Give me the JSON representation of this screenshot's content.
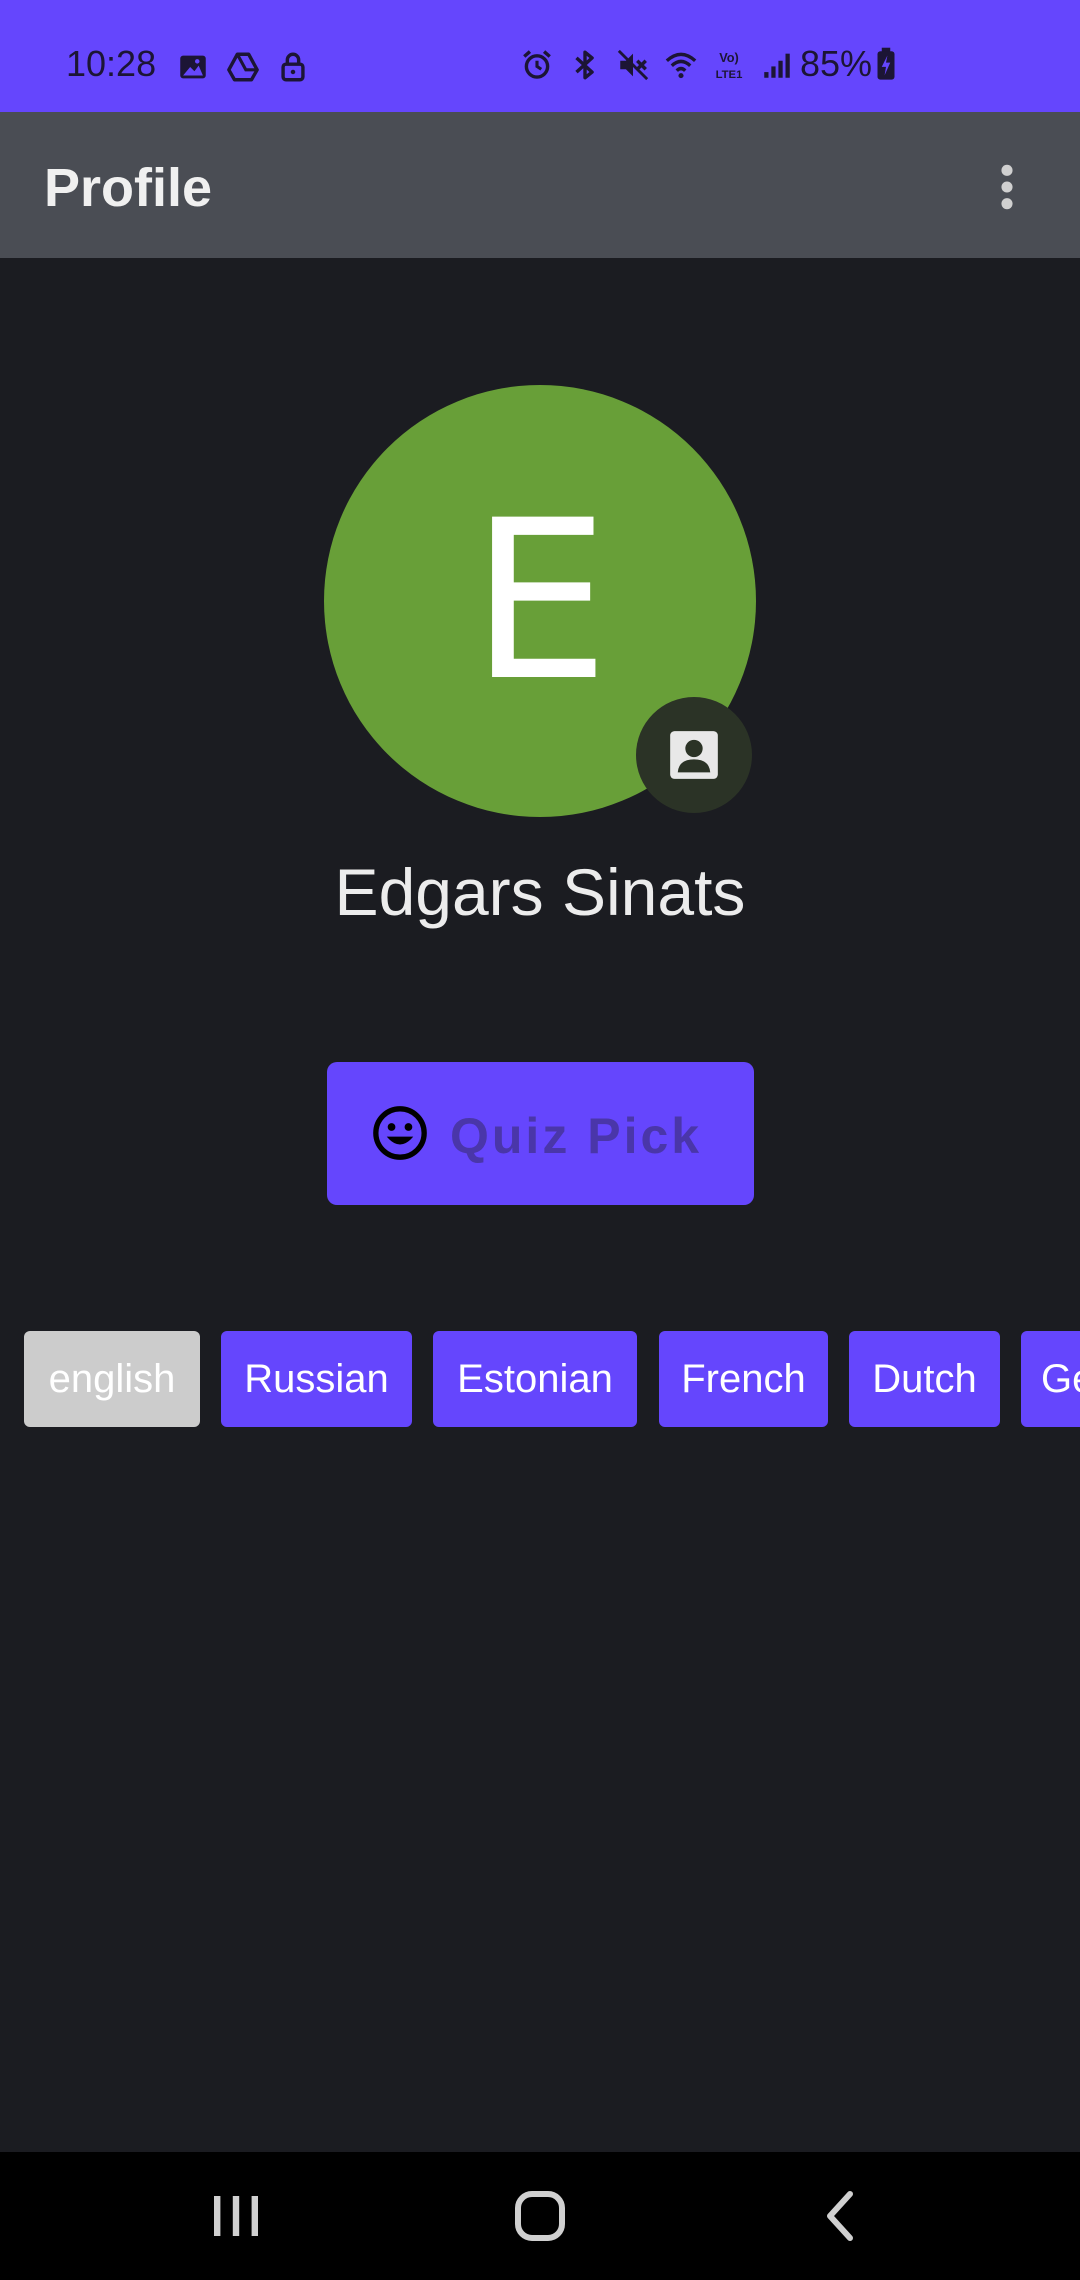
{
  "status_bar": {
    "time": "10:28",
    "battery": "85%",
    "left_icons": [
      "image-icon",
      "drive-icon",
      "lock-icon"
    ],
    "right_icons": [
      "alarm-icon",
      "bluetooth-icon",
      "mute-icon",
      "wifi-icon",
      "volte-icon",
      "signal-icon",
      "battery-charging-icon"
    ],
    "color": "#6546fd"
  },
  "app_bar": {
    "title": "Profile",
    "menu_icon": "more-vert-icon"
  },
  "profile": {
    "avatar_letter": "E",
    "avatar_color": "#689f38",
    "badge_icon": "contact-icon",
    "name": "Edgars Sinats"
  },
  "quiz_button": {
    "icon": "smiley-icon",
    "label": "Quiz Pick",
    "color": "#6546fd"
  },
  "languages": {
    "selected": "english",
    "items": [
      {
        "label": "english",
        "selected": true
      },
      {
        "label": "Russian",
        "selected": false
      },
      {
        "label": "Estonian",
        "selected": false
      },
      {
        "label": "French",
        "selected": false
      },
      {
        "label": "Dutch",
        "selected": false
      },
      {
        "label": "German",
        "selected": false
      }
    ]
  },
  "nav_bar": {
    "buttons": [
      "recent-apps-icon",
      "home-icon",
      "back-icon"
    ]
  }
}
